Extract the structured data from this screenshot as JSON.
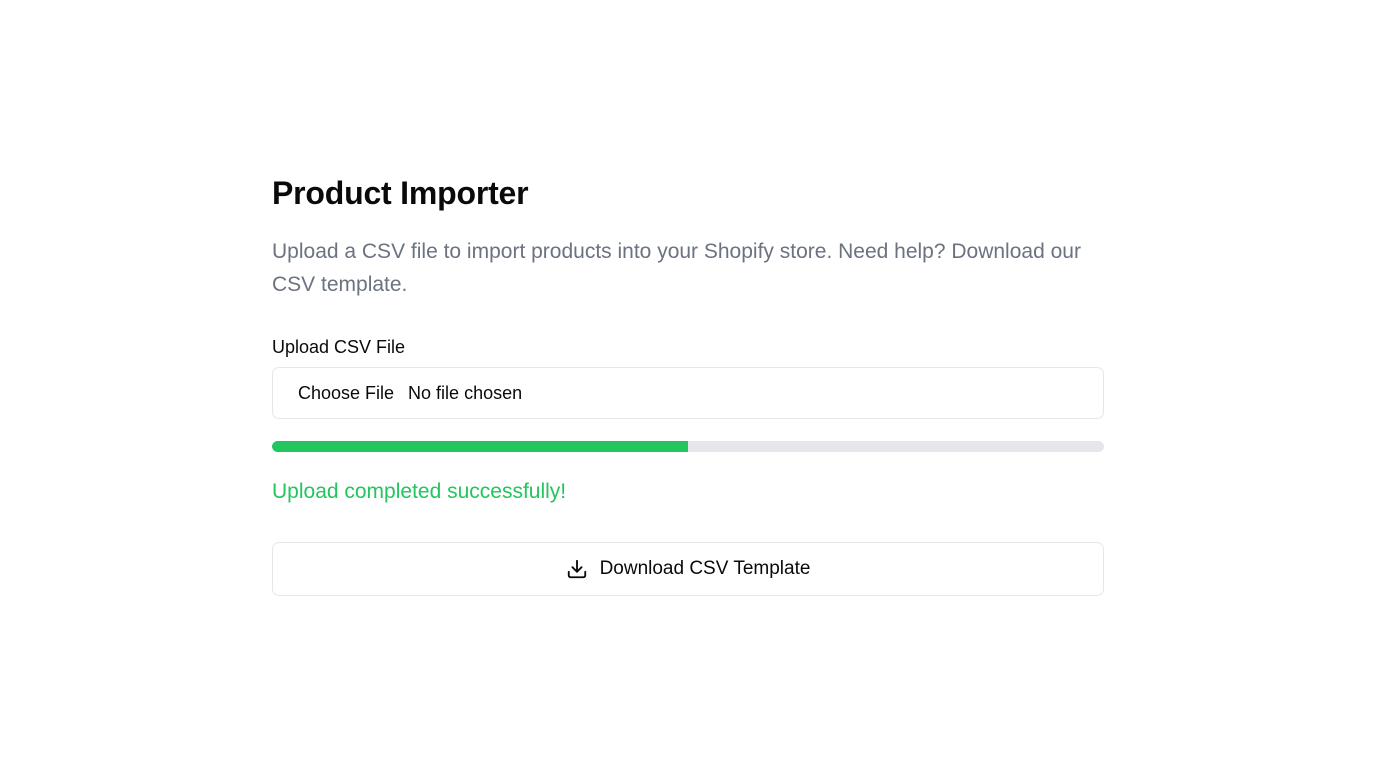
{
  "page": {
    "title": "Product Importer",
    "description": "Upload a CSV file to import products into your Shopify store. Need help? Download our CSV template."
  },
  "upload": {
    "label": "Upload CSV File",
    "choose_button": "Choose File",
    "file_status": "No file chosen"
  },
  "progress": {
    "percent": 50
  },
  "status": {
    "message": "Upload completed successfully!"
  },
  "download": {
    "label": "Download CSV Template",
    "icon": "download-icon"
  },
  "colors": {
    "success": "#22c55e",
    "progress_track": "#e5e7eb",
    "muted_text": "#6b7280",
    "border": "#e5e7eb"
  }
}
